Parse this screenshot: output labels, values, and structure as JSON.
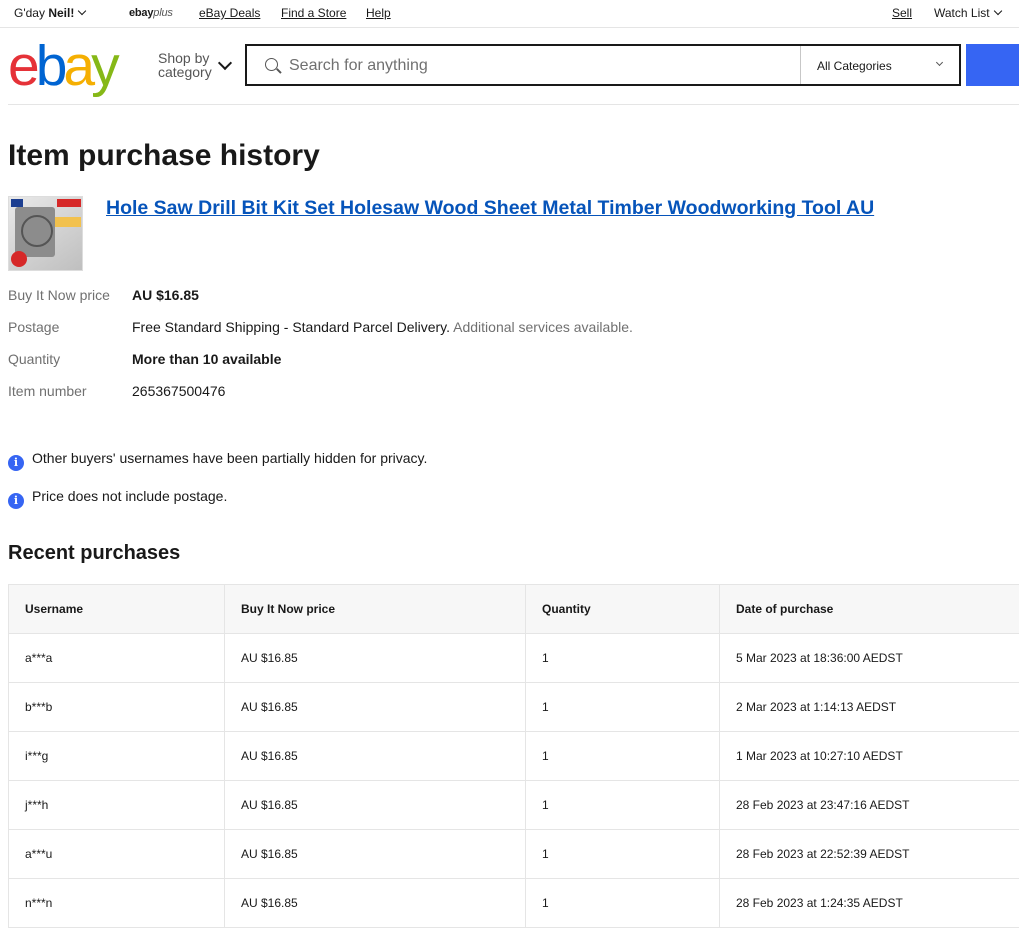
{
  "topbar": {
    "greeting_prefix": "G'day",
    "greeting_name": "Neil!",
    "ebayplus_e": "ebay",
    "ebayplus_p": "plus",
    "deals": "eBay Deals",
    "find_store": "Find a Store",
    "help": "Help",
    "sell": "Sell",
    "watch_list": "Watch List"
  },
  "header": {
    "logo_e": "e",
    "logo_b": "b",
    "logo_a": "a",
    "logo_y": "y",
    "shop_by_line1": "Shop by",
    "shop_by_line2": "category",
    "search_placeholder": "Search for anything",
    "category_selected": "All Categories"
  },
  "page": {
    "title": "Item purchase history"
  },
  "item": {
    "title": "Hole Saw Drill Bit Kit Set Holesaw Wood Sheet Metal Timber Woodworking Tool AU",
    "thumbnail_badge": "17x",
    "details": [
      {
        "label": "Buy It Now price",
        "value": "AU $16.85",
        "extra": ""
      },
      {
        "label": "Postage",
        "value": "Free Standard Shipping - Standard Parcel Delivery.",
        "extra": "Additional services available."
      },
      {
        "label": "Quantity",
        "value": "More than 10 available",
        "extra": ""
      },
      {
        "label": "Item number",
        "value": "265367500476",
        "extra": ""
      }
    ]
  },
  "notices": [
    "Other buyers' usernames have been partially hidden for privacy.",
    "Price does not include postage."
  ],
  "recent": {
    "heading": "Recent purchases",
    "columns": [
      "Username",
      "Buy It Now price",
      "Quantity",
      "Date of purchase"
    ],
    "rows": [
      [
        "a***a",
        "AU $16.85",
        "1",
        "5 Mar 2023 at 18:36:00 AEDST"
      ],
      [
        "b***b",
        "AU $16.85",
        "1",
        "2 Mar 2023 at 1:14:13 AEDST"
      ],
      [
        "i***g",
        "AU $16.85",
        "1",
        "1 Mar 2023 at 10:27:10 AEDST"
      ],
      [
        "j***h",
        "AU $16.85",
        "1",
        "28 Feb 2023 at 23:47:16 AEDST"
      ],
      [
        "a***u",
        "AU $16.85",
        "1",
        "28 Feb 2023 at 22:52:39 AEDST"
      ],
      [
        "n***n",
        "AU $16.85",
        "1",
        "28 Feb 2023 at 1:24:35 AEDST"
      ]
    ]
  },
  "colors": {
    "accent_blue": "#3665f3",
    "link_blue": "#0654ba",
    "logo_red": "#e53238",
    "logo_blue": "#0064d2",
    "logo_yellow": "#f5af02",
    "logo_green": "#86b817"
  },
  "icons": {
    "info": "info-circle-icon",
    "search": "magnifier-icon"
  }
}
